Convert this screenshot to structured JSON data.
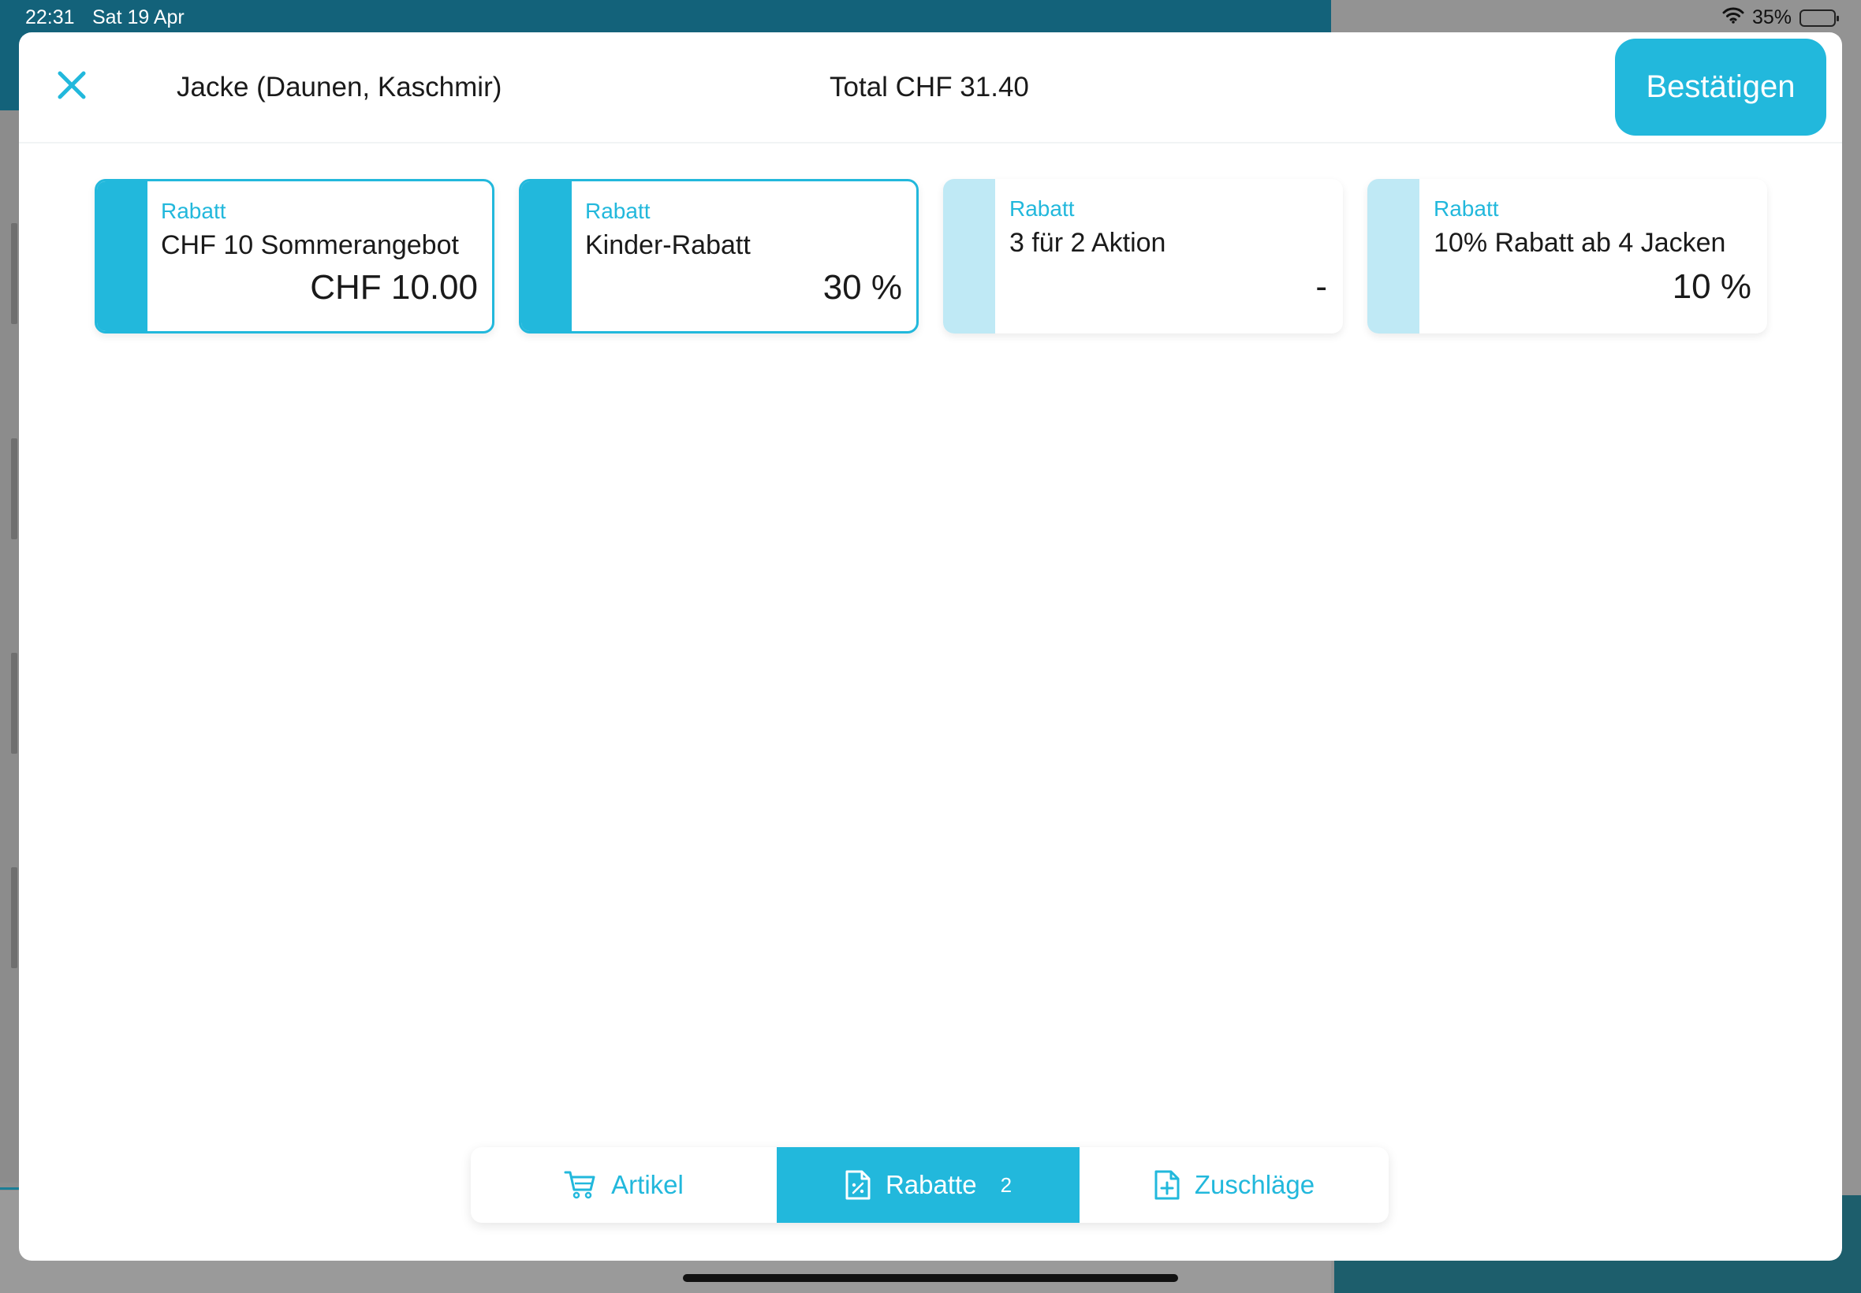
{
  "status_bar": {
    "time": "22:31",
    "date": "Sat 19 Apr",
    "battery_percent": "35%",
    "battery_level": 0.35
  },
  "modal": {
    "close_icon": "close-icon",
    "article_title": "Jacke (Daunen, Kaschmir)",
    "total": "Total CHF 31.40",
    "confirm_label": "Bestätigen"
  },
  "discounts": [
    {
      "type": "Rabatt",
      "name": "CHF 10 Sommerangebot",
      "value": "CHF 10.00",
      "selected": true
    },
    {
      "type": "Rabatt",
      "name": "Kinder-Rabatt",
      "value": "30 %",
      "selected": true
    },
    {
      "type": "Rabatt",
      "name": "3 für 2 Aktion",
      "value": "-",
      "selected": false
    },
    {
      "type": "Rabatt",
      "name": "10% Rabatt ab 4 Jacken",
      "value": "10 %",
      "selected": false
    }
  ],
  "tabs": [
    {
      "label": "Artikel",
      "icon": "cart-icon",
      "active": false
    },
    {
      "label": "Rabatte",
      "icon": "discount-document-icon",
      "badge": "2",
      "active": true
    },
    {
      "label": "Zuschläge",
      "icon": "add-document-icon",
      "active": false
    }
  ],
  "colors": {
    "accent": "#22b8dc",
    "accent_light": "#bfe9f5",
    "background_header": "#13627a"
  }
}
